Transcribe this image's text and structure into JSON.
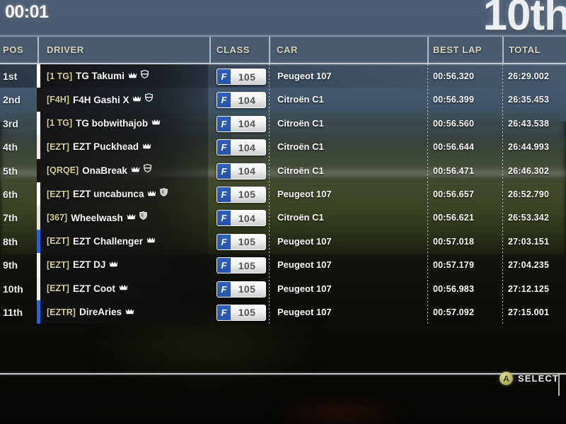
{
  "hud": {
    "race_timer": "00:01",
    "player_position": "10th"
  },
  "table": {
    "headers": {
      "pos": "POS",
      "driver": "DRIVER",
      "class": "CLASS",
      "car": "CAR",
      "best_lap": "BEST LAP",
      "total": "TOTAL"
    },
    "rows": [
      {
        "pos": "1st",
        "tag": "[1 TG]",
        "name": "TG Takumi",
        "icons": [
          "crown-icon",
          "shield-banded-icon"
        ],
        "class_prefix": "F",
        "class_number": "105",
        "car": "Peugeot 107",
        "best_lap": "00:56.320",
        "total": "26:29.002",
        "marker_color": "#ffffff"
      },
      {
        "pos": "2nd",
        "tag": "[F4H]",
        "name": "F4H Gashi X",
        "icons": [
          "crown-icon",
          "shield-banded-icon"
        ],
        "class_prefix": "F",
        "class_number": "104",
        "car": "Citroën C1",
        "best_lap": "00:56.399",
        "total": "26:35.453",
        "marker_color": "#1a1712"
      },
      {
        "pos": "3rd",
        "tag": "[1 TG]",
        "name": "TG bobwithajob",
        "icons": [
          "crown-icon"
        ],
        "class_prefix": "F",
        "class_number": "104",
        "car": "Citroën C1",
        "best_lap": "00:56.560",
        "total": "26:43.538",
        "marker_color": "#ffffff"
      },
      {
        "pos": "4th",
        "tag": "[EZT]",
        "name": "EZT Puckhead",
        "icons": [
          "crown-icon"
        ],
        "class_prefix": "F",
        "class_number": "104",
        "car": "Citroën C1",
        "best_lap": "00:56.644",
        "total": "26:44.993",
        "marker_color": "#f2f0e8"
      },
      {
        "pos": "5th",
        "tag": "[QRQE]",
        "name": "OnaBreak",
        "icons": [
          "crown-icon",
          "shield-banded-icon"
        ],
        "class_prefix": "F",
        "class_number": "104",
        "car": "Citroën C1",
        "best_lap": "00:56.471",
        "total": "26:46.302",
        "marker_color": "#15120e"
      },
      {
        "pos": "6th",
        "tag": "[EZT]",
        "name": "EZT uncabunca",
        "icons": [
          "crown-icon",
          "shield-solid-icon"
        ],
        "class_prefix": "F",
        "class_number": "105",
        "car": "Peugeot 107",
        "best_lap": "00:56.657",
        "total": "26:52.790",
        "marker_color": "#ffffff"
      },
      {
        "pos": "7th",
        "tag": "[367]",
        "name": "Wheelwash",
        "icons": [
          "crown-icon",
          "shield-solid-icon"
        ],
        "class_prefix": "F",
        "class_number": "104",
        "car": "Citroën C1",
        "best_lap": "00:56.621",
        "total": "26:53.342",
        "marker_color": "#e8e6dd"
      },
      {
        "pos": "8th",
        "tag": "[EZT]",
        "name": "EZT Challenger",
        "icons": [
          "crown-icon"
        ],
        "class_prefix": "F",
        "class_number": "105",
        "car": "Peugeot 107",
        "best_lap": "00:57.018",
        "total": "27:03.151",
        "marker_color": "#2f5fd8"
      },
      {
        "pos": "9th",
        "tag": "[EZT]",
        "name": "EZT DJ",
        "icons": [
          "crown-icon"
        ],
        "class_prefix": "F",
        "class_number": "105",
        "car": "Peugeot 107",
        "best_lap": "00:57.179",
        "total": "27:04.235",
        "marker_color": "#f6f5ef"
      },
      {
        "pos": "10th",
        "tag": "[EZT]",
        "name": "EZT Coot",
        "icons": [
          "crown-icon"
        ],
        "class_prefix": "F",
        "class_number": "105",
        "car": "Peugeot 107",
        "best_lap": "00:56.983",
        "total": "27:12.125",
        "marker_color": "#f2f1ea"
      },
      {
        "pos": "11th",
        "tag": "[EZTR]",
        "name": "DireAries",
        "icons": [
          "crown-icon"
        ],
        "class_prefix": "F",
        "class_number": "105",
        "car": "Peugeot 107",
        "best_lap": "00:57.092",
        "total": "27:15.001",
        "marker_color": "#2f5fd8"
      }
    ]
  },
  "footer": {
    "button_glyph": "A",
    "button_label": "SELECT"
  },
  "colors": {
    "header_text": "#ded9bd",
    "tag_text": "#d9cf9b",
    "row_text": "#ffffff",
    "plate_blue": "#2554ad",
    "button_yellow": "#b9b865"
  }
}
